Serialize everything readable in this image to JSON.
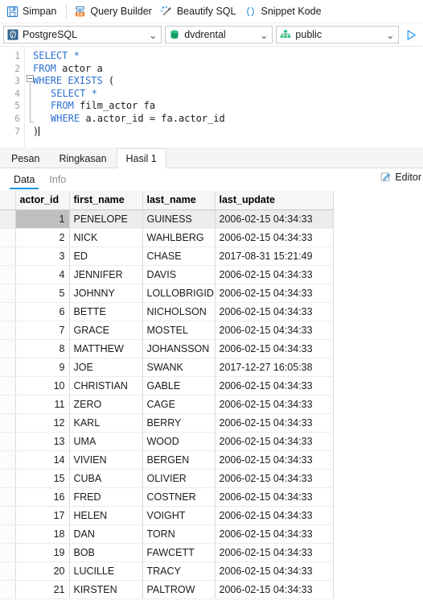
{
  "toolbar": {
    "items": [
      {
        "label": "Simpan",
        "icon": "save-icon"
      },
      {
        "label": "Query Builder",
        "icon": "query-builder-icon"
      },
      {
        "label": "Beautify SQL",
        "icon": "magic-wand-icon"
      },
      {
        "label": "Snippet Kode",
        "icon": "code-snippet-icon"
      }
    ]
  },
  "connection": {
    "driver": "PostgreSQL",
    "database": "dvdrental",
    "schema": "public",
    "chevron": "⌄",
    "run_title": "Run"
  },
  "editor": {
    "lines": [
      {
        "n": "1",
        "tokens": [
          {
            "t": "SELECT *",
            "k": true
          }
        ],
        "indent": 0
      },
      {
        "n": "2",
        "tokens": [
          {
            "t": "FROM ",
            "k": true
          },
          {
            "t": "actor a",
            "k": false
          }
        ],
        "indent": 0
      },
      {
        "n": "3",
        "tokens": [
          {
            "t": "WHERE EXISTS",
            "k": true
          },
          {
            "t": " (",
            "k": false
          }
        ],
        "indent": 0
      },
      {
        "n": "4",
        "tokens": [
          {
            "t": "SELECT *",
            "k": true
          }
        ],
        "indent": 1
      },
      {
        "n": "5",
        "tokens": [
          {
            "t": "FROM ",
            "k": true
          },
          {
            "t": "film_actor fa",
            "k": false
          }
        ],
        "indent": 1
      },
      {
        "n": "6",
        "tokens": [
          {
            "t": "WHERE ",
            "k": true
          },
          {
            "t": "a.actor_id = fa.actor_id",
            "k": false
          }
        ],
        "indent": 1
      },
      {
        "n": "7",
        "tokens": [
          {
            "t": ")",
            "k": false
          }
        ],
        "indent": 0
      }
    ]
  },
  "result_tabs": {
    "items": [
      "Pesan",
      "Ringkasan",
      "Hasil 1"
    ],
    "active_index": 2
  },
  "sub_tabs": {
    "items": [
      "Data",
      "Info"
    ],
    "active_index": 0,
    "editor_label": "Editor"
  },
  "grid": {
    "columns": [
      "actor_id",
      "first_name",
      "last_name",
      "last_update"
    ],
    "selected_row": 0,
    "selected_column": 0,
    "rows": [
      [
        "1",
        "PENELOPE",
        "GUINESS",
        "2006-02-15 04:34:33"
      ],
      [
        "2",
        "NICK",
        "WAHLBERG",
        "2006-02-15 04:34:33"
      ],
      [
        "3",
        "ED",
        "CHASE",
        "2017-08-31 15:21:49"
      ],
      [
        "4",
        "JENNIFER",
        "DAVIS",
        "2006-02-15 04:34:33"
      ],
      [
        "5",
        "JOHNNY",
        "LOLLOBRIGID.",
        "2006-02-15 04:34:33"
      ],
      [
        "6",
        "BETTE",
        "NICHOLSON",
        "2006-02-15 04:34:33"
      ],
      [
        "7",
        "GRACE",
        "MOSTEL",
        "2006-02-15 04:34:33"
      ],
      [
        "8",
        "MATTHEW",
        "JOHANSSON",
        "2006-02-15 04:34:33"
      ],
      [
        "9",
        "JOE",
        "SWANK",
        "2017-12-27 16:05:38"
      ],
      [
        "10",
        "CHRISTIAN",
        "GABLE",
        "2006-02-15 04:34:33"
      ],
      [
        "11",
        "ZERO",
        "CAGE",
        "2006-02-15 04:34:33"
      ],
      [
        "12",
        "KARL",
        "BERRY",
        "2006-02-15 04:34:33"
      ],
      [
        "13",
        "UMA",
        "WOOD",
        "2006-02-15 04:34:33"
      ],
      [
        "14",
        "VIVIEN",
        "BERGEN",
        "2006-02-15 04:34:33"
      ],
      [
        "15",
        "CUBA",
        "OLIVIER",
        "2006-02-15 04:34:33"
      ],
      [
        "16",
        "FRED",
        "COSTNER",
        "2006-02-15 04:34:33"
      ],
      [
        "17",
        "HELEN",
        "VOIGHT",
        "2006-02-15 04:34:33"
      ],
      [
        "18",
        "DAN",
        "TORN",
        "2006-02-15 04:34:33"
      ],
      [
        "19",
        "BOB",
        "FAWCETT",
        "2006-02-15 04:34:33"
      ],
      [
        "20",
        "LUCILLE",
        "TRACY",
        "2006-02-15 04:34:33"
      ],
      [
        "21",
        "KIRSTEN",
        "PALTROW",
        "2006-02-15 04:34:33"
      ]
    ]
  },
  "colors": {
    "accent": "#1b97e3",
    "keyword": "#2c6fd1",
    "run": "#2196f3",
    "db_green": "#19a974",
    "pg_blue": "#336791"
  }
}
